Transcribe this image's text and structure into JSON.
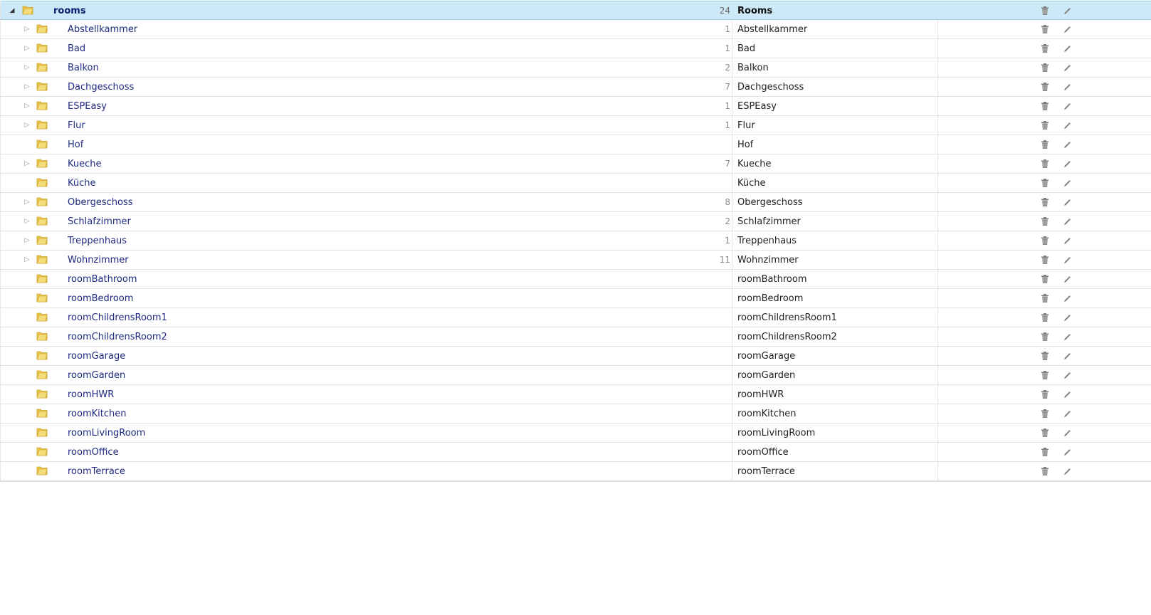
{
  "tree": {
    "root": {
      "name": "rooms",
      "count": "24",
      "title": "Rooms",
      "expanded": true
    },
    "children": [
      {
        "name": "Abstellkammer",
        "count": "1",
        "title": "Abstellkammer",
        "has_children": true
      },
      {
        "name": "Bad",
        "count": "1",
        "title": "Bad",
        "has_children": true
      },
      {
        "name": "Balkon",
        "count": "2",
        "title": "Balkon",
        "has_children": true
      },
      {
        "name": "Dachgeschoss",
        "count": "7",
        "title": "Dachgeschoss",
        "has_children": true
      },
      {
        "name": "ESPEasy",
        "count": "1",
        "title": "ESPEasy",
        "has_children": true
      },
      {
        "name": "Flur",
        "count": "1",
        "title": "Flur",
        "has_children": true
      },
      {
        "name": "Hof",
        "count": "",
        "title": "Hof",
        "has_children": false
      },
      {
        "name": "Kueche",
        "count": "7",
        "title": "Kueche",
        "has_children": true
      },
      {
        "name": "Küche",
        "count": "",
        "title": "Küche",
        "has_children": false
      },
      {
        "name": "Obergeschoss",
        "count": "8",
        "title": "Obergeschoss",
        "has_children": true
      },
      {
        "name": "Schlafzimmer",
        "count": "2",
        "title": "Schlafzimmer",
        "has_children": true
      },
      {
        "name": "Treppenhaus",
        "count": "1",
        "title": "Treppenhaus",
        "has_children": true
      },
      {
        "name": "Wohnzimmer",
        "count": "11",
        "title": "Wohnzimmer",
        "has_children": true
      },
      {
        "name": "roomBathroom",
        "count": "",
        "title": "roomBathroom",
        "has_children": false
      },
      {
        "name": "roomBedroom",
        "count": "",
        "title": "roomBedroom",
        "has_children": false
      },
      {
        "name": "roomChildrensRoom1",
        "count": "",
        "title": "roomChildrensRoom1",
        "has_children": false
      },
      {
        "name": "roomChildrensRoom2",
        "count": "",
        "title": "roomChildrensRoom2",
        "has_children": false
      },
      {
        "name": "roomGarage",
        "count": "",
        "title": "roomGarage",
        "has_children": false
      },
      {
        "name": "roomGarden",
        "count": "",
        "title": "roomGarden",
        "has_children": false
      },
      {
        "name": "roomHWR",
        "count": "",
        "title": "roomHWR",
        "has_children": false
      },
      {
        "name": "roomKitchen",
        "count": "",
        "title": "roomKitchen",
        "has_children": false
      },
      {
        "name": "roomLivingRoom",
        "count": "",
        "title": "roomLivingRoom",
        "has_children": false
      },
      {
        "name": "roomOffice",
        "count": "",
        "title": "roomOffice",
        "has_children": false
      },
      {
        "name": "roomTerrace",
        "count": "",
        "title": "roomTerrace",
        "has_children": false
      }
    ]
  },
  "icons": {
    "expanded": "triangle-down-icon",
    "collapsed": "triangle-right-icon",
    "folder": "folder-icon",
    "delete": "trash-icon",
    "edit": "pencil-icon"
  },
  "colors": {
    "selected_row": "#cde8f6",
    "folder": "#e8c54a",
    "link_text": "#1f2a80"
  }
}
